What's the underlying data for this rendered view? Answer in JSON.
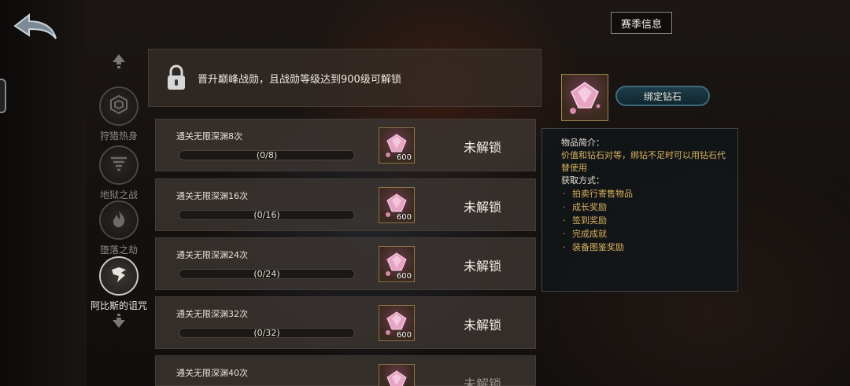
{
  "header": {
    "season_button": "赛季信息"
  },
  "nav": {
    "items": [
      {
        "label": "狩猎热身",
        "active": false,
        "icon": "hexagon-icon"
      },
      {
        "label": "地狱之战",
        "active": false,
        "icon": "vortex-icon"
      },
      {
        "label": "堕落之劫",
        "active": false,
        "icon": "flame-icon"
      },
      {
        "label": "阿比斯的诅咒",
        "active": true,
        "icon": "claw-icon"
      }
    ]
  },
  "lock_banner": {
    "text": "晋升巅峰战勋，且战勋等级达到900级可解锁"
  },
  "tasks": [
    {
      "title": "通关无限深渊8次",
      "progress": "(0/8)",
      "progress_value": 0,
      "reward_count": "600",
      "status": "未解锁"
    },
    {
      "title": "通关无限深渊16次",
      "progress": "(0/16)",
      "progress_value": 0,
      "reward_count": "600",
      "status": "未解锁"
    },
    {
      "title": "通关无限深渊24次",
      "progress": "(0/24)",
      "progress_value": 0,
      "reward_count": "600",
      "status": "未解锁"
    },
    {
      "title": "通关无限深渊32次",
      "progress": "(0/32)",
      "progress_value": 0,
      "reward_count": "600",
      "status": "未解锁"
    },
    {
      "title": "通关无限深渊40次",
      "progress": "",
      "progress_value": 0,
      "reward_count": "",
      "status": "未解锁"
    }
  ],
  "item_info": {
    "name": "绑定钻石",
    "intro_label": "物品简介：",
    "description": "价值和钻石对等，绑钻不足时可以用钻石代替使用",
    "source_label": "获取方式：",
    "sources": [
      "拍卖行寄售物品",
      "成长奖励",
      "签到奖励",
      "完成成就",
      "装备图鉴奖励"
    ]
  },
  "colors": {
    "accent_gold": "#d7b25f",
    "status_text": "#f4efe6"
  }
}
